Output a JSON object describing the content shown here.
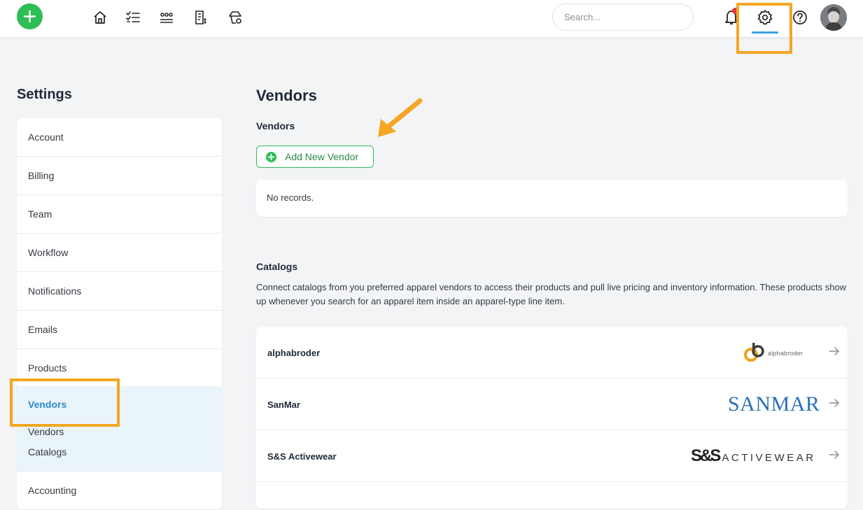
{
  "colors": {
    "accent_green": "#2fbd55",
    "accent_blue": "#3aa3de",
    "active_text": "#2d8bc9",
    "highlight": "#f5a623",
    "sanmar_blue": "#2a6fb6",
    "notification_red": "#e53935"
  },
  "topbar": {
    "add_icon": "plus-icon",
    "nav_icons": [
      "home-icon",
      "checklist-icon",
      "customers-icon",
      "invoice-icon",
      "products-icon"
    ],
    "search_placeholder": "Search...",
    "right_icons": [
      "bell-icon",
      "gear-icon",
      "help-icon",
      "avatar"
    ]
  },
  "sidebar": {
    "title": "Settings",
    "items": [
      {
        "label": "Account"
      },
      {
        "label": "Billing"
      },
      {
        "label": "Team"
      },
      {
        "label": "Workflow"
      },
      {
        "label": "Notifications"
      },
      {
        "label": "Emails"
      },
      {
        "label": "Products"
      }
    ],
    "active": {
      "label": "Vendors",
      "subitems": [
        "Vendors",
        "Catalogs"
      ]
    },
    "after": {
      "label": "Accounting"
    }
  },
  "main": {
    "title": "Vendors",
    "vendors": {
      "title": "Vendors",
      "add_button": "Add New Vendor",
      "empty_text": "No records."
    },
    "catalogs": {
      "title": "Catalogs",
      "description": "Connect catalogs from you preferred apparel vendors to access their products and pull live pricing and inventory information. These products show up whenever you search for an apparel item inside an apparel-type line item.",
      "rows": [
        {
          "name": "alphabroder",
          "logo_text": "alphabroder"
        },
        {
          "name": "SanMar",
          "logo_text": "SANMAR"
        },
        {
          "name": "S&S Activewear",
          "logo_s": "S&S",
          "logo_text": "ACTIVEWEAR"
        }
      ]
    }
  }
}
